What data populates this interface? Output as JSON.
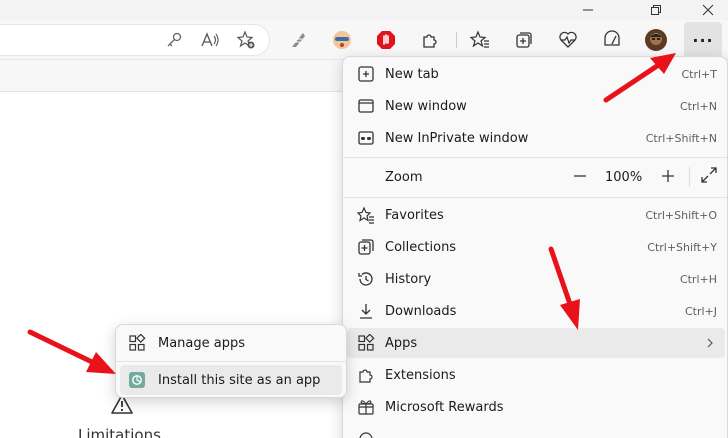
{
  "menu": {
    "items": [
      {
        "label": "New tab",
        "shortcut": "Ctrl+T",
        "icon": "new-tab-icon"
      },
      {
        "label": "New window",
        "shortcut": "Ctrl+N",
        "icon": "new-window-icon"
      },
      {
        "label": "New InPrivate window",
        "shortcut": "Ctrl+Shift+N",
        "icon": "inprivate-icon"
      },
      {
        "label": "Favorites",
        "shortcut": "Ctrl+Shift+O",
        "icon": "favorites-icon"
      },
      {
        "label": "Collections",
        "shortcut": "Ctrl+Shift+Y",
        "icon": "collections-icon"
      },
      {
        "label": "History",
        "shortcut": "Ctrl+H",
        "icon": "history-icon"
      },
      {
        "label": "Downloads",
        "shortcut": "Ctrl+J",
        "icon": "downloads-icon"
      },
      {
        "label": "Apps",
        "shortcut": "",
        "icon": "apps-icon"
      },
      {
        "label": "Extensions",
        "shortcut": "",
        "icon": "extensions-icon"
      },
      {
        "label": "Microsoft Rewards",
        "shortcut": "",
        "icon": "rewards-icon"
      }
    ],
    "zoom": {
      "label": "Zoom",
      "value": "100%",
      "minus": "—",
      "plus": "+"
    }
  },
  "apps_submenu": {
    "items": [
      {
        "label": "Manage apps",
        "icon": "apps-icon"
      },
      {
        "label": "Install this site as an app",
        "icon": "site-app-icon"
      }
    ]
  },
  "page": {
    "limitations": "Limitations"
  },
  "toolbar": {
    "more_button": "···"
  },
  "colors": {
    "arrow": "#e8131a",
    "menu_bg": "#f9f9f9",
    "hover": "#eaeaea"
  }
}
